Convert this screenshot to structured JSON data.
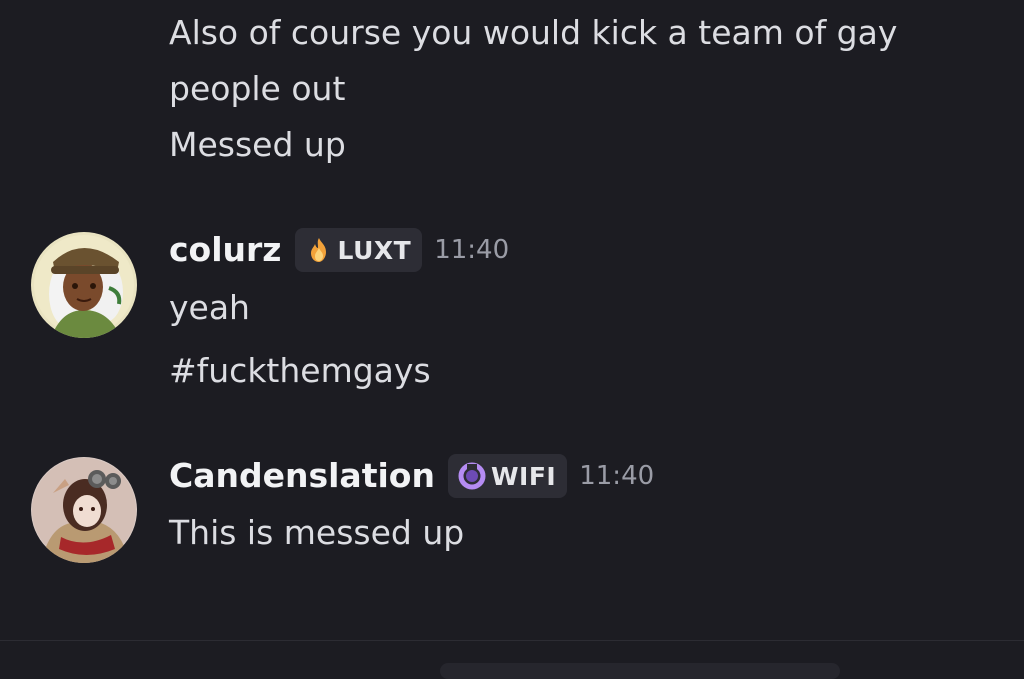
{
  "messages": {
    "prev": {
      "lines": [
        "Also of course you would kick a team of gay people out",
        "Messed up"
      ]
    },
    "colurz": {
      "username": "colurz",
      "tag": "LUXT",
      "tag_icon": "flame-icon",
      "time": "11:40",
      "lines": [
        "yeah",
        "#fuckthemgays"
      ]
    },
    "candenslation": {
      "username": "Candenslation",
      "tag": "WIFI",
      "tag_icon": "moon-ring-icon",
      "time": "11:40",
      "lines": [
        "This is messed up"
      ]
    }
  },
  "colors": {
    "background": "#1c1c22",
    "tag_background": "#2d2d35",
    "text": "#dcdde2",
    "username": "#f2f3f5",
    "timestamp": "#9a9ca6"
  }
}
